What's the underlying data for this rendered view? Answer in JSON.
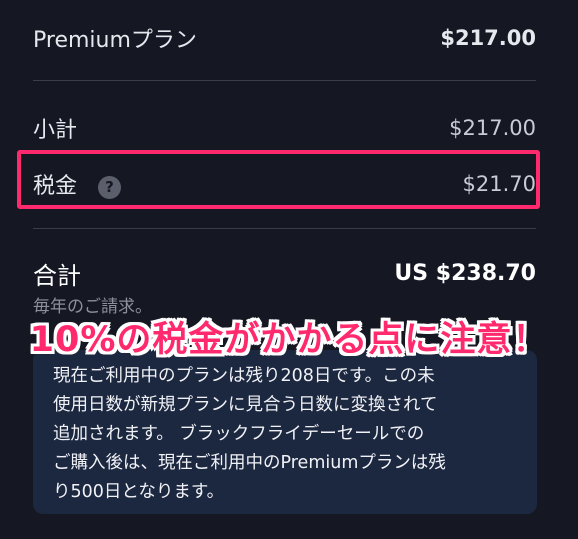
{
  "plan": {
    "label": "Premiumプラン",
    "amount": "$217.00"
  },
  "subtotal": {
    "label": "小計",
    "amount": "$217.00"
  },
  "tax": {
    "label": "税金",
    "help_icon": "question-circle-icon",
    "amount": "$21.70"
  },
  "total": {
    "label": "合計",
    "amount": "US $238.70",
    "billing_note": "毎年のご請求。"
  },
  "annotation": {
    "text": "10%の税金がかかる点に注意！",
    "color": "#ff2a6d"
  },
  "info": {
    "lines": [
      "現在ご利用中のプランは残り208日です。この未",
      "使用日数が新規プランに見合う日数に変換されて",
      "追加されます。 ブラックフライデーセールでの",
      "ご購入後は、現在ご利用中のPremiumプランは残",
      "り500日となります。"
    ]
  },
  "colors": {
    "background": "#151823",
    "highlight_border": "#ff2a6d",
    "info_box": "#1c2740"
  }
}
